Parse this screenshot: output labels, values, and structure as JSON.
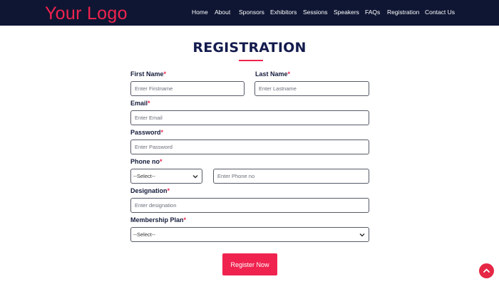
{
  "header": {
    "logo_text": "Your Logo",
    "nav": [
      "Home",
      "About",
      "Sponsors",
      "Exhibitors",
      "Sessions",
      "Speakers",
      "FAQs",
      "Registration",
      "Contact Us"
    ]
  },
  "page": {
    "title": "REGISTRATION"
  },
  "form": {
    "required_marker": "*",
    "first_name": {
      "label": "First Name",
      "placeholder": "Enter Firstname",
      "value": ""
    },
    "last_name": {
      "label": "Last Name",
      "placeholder": "Enter Lastname",
      "value": ""
    },
    "email": {
      "label": "Email",
      "placeholder": "Enter Email",
      "value": ""
    },
    "password": {
      "label": "Password",
      "placeholder": "Enter Password",
      "value": ""
    },
    "phone": {
      "label": "Phone no",
      "code_selected": "--Select--",
      "placeholder": "Enter Phone no",
      "value": ""
    },
    "designation": {
      "label": "Designation",
      "placeholder": "Enter designation",
      "value": ""
    },
    "membership": {
      "label": "Membership Plan",
      "selected": "--Select--"
    },
    "submit_label": "Register Now"
  },
  "colors": {
    "navbar_bg": "#0f1633",
    "accent": "#f0234f",
    "title": "#141b4d"
  },
  "icons": {
    "select_arrow": "chevron-down-icon",
    "scroll_top": "chevron-up-icon"
  }
}
